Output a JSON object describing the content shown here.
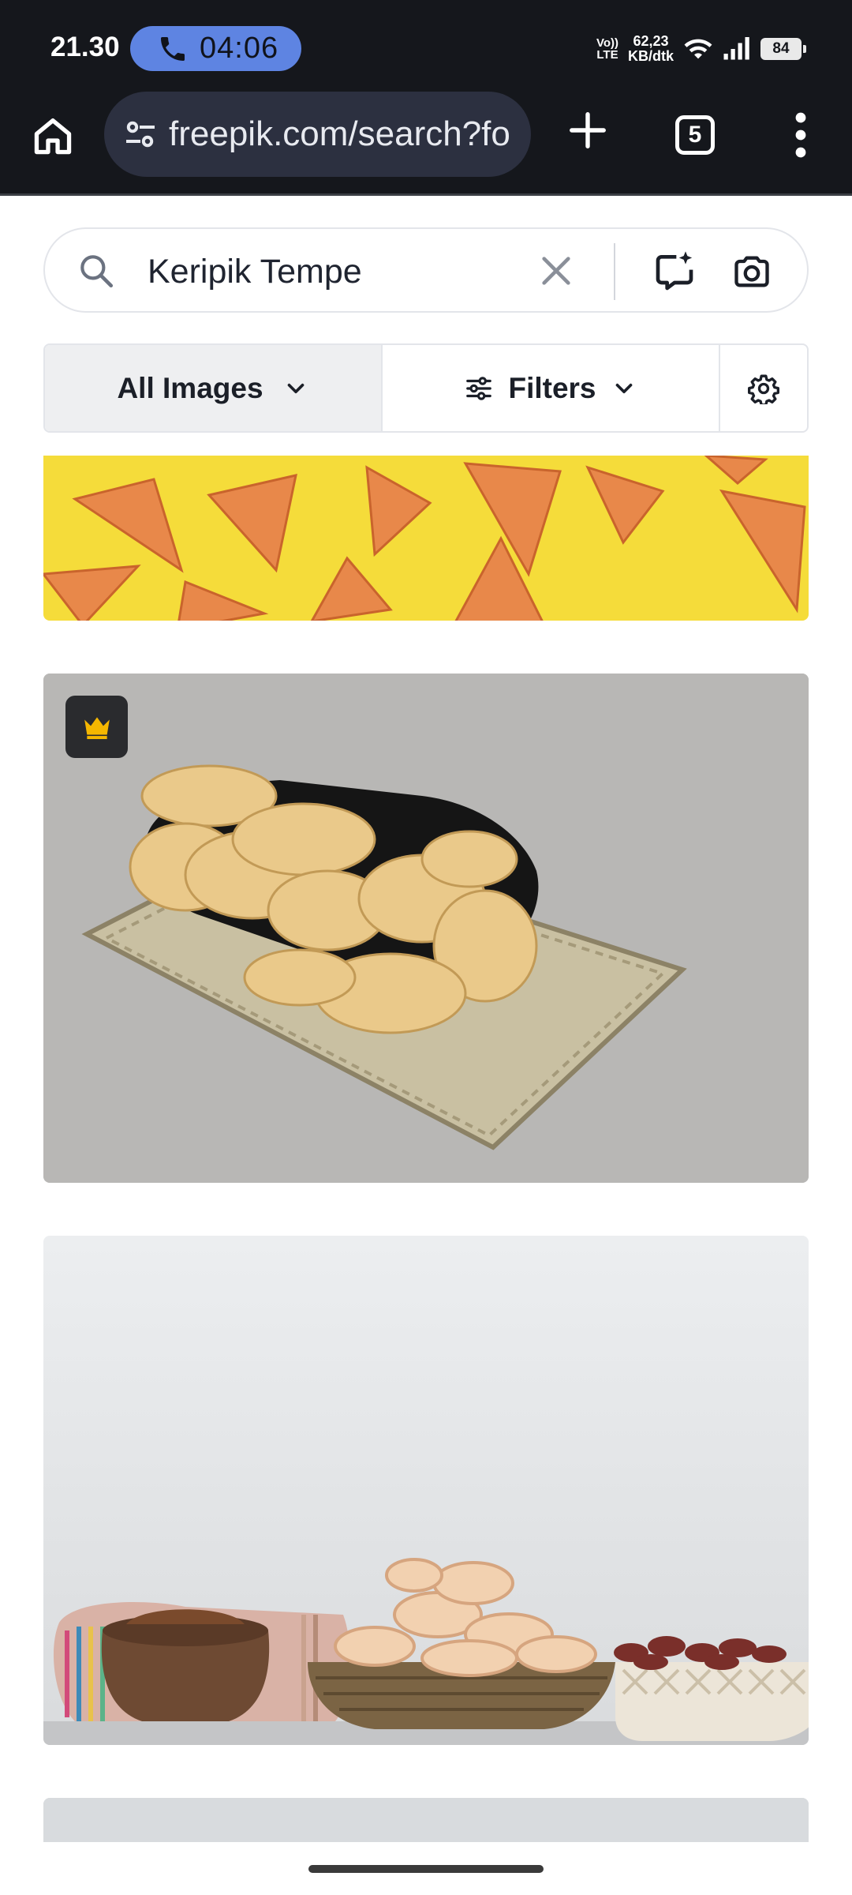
{
  "status_bar": {
    "time": "21.30",
    "call_timer": "04:06",
    "volte_line1": "Vo))",
    "volte_line2": "LTE",
    "net_speed_value": "62,23",
    "net_speed_unit": "KB/dtk",
    "battery": "84",
    "icons": [
      "phone-icon",
      "wifi-icon",
      "signal-icon",
      "battery-icon"
    ]
  },
  "browser": {
    "url": "freepik.com/search?fo",
    "tab_count": "5",
    "icons": [
      "home-icon",
      "site-settings-icon",
      "new-tab-icon",
      "tab-switcher-icon",
      "more-menu-icon"
    ]
  },
  "search": {
    "query": "Keripik Tempe",
    "icons": [
      "search-icon",
      "clear-icon",
      "ai-chat-icon",
      "camera-search-icon"
    ]
  },
  "filters": {
    "all_images_label": "All Images",
    "filters_label": "Filters",
    "icons": [
      "chevron-down-icon",
      "sliders-icon",
      "gear-icon"
    ]
  },
  "results": [
    {
      "kind": "photo",
      "premium": false
    },
    {
      "kind": "photo",
      "premium": true
    },
    {
      "kind": "photo",
      "premium": false
    },
    {
      "kind": "photo",
      "premium": false
    }
  ],
  "colors": {
    "status_bar_bg": "#15171c",
    "call_chip": "#5e84e2",
    "omnibox_bg": "#2c3040",
    "active_filter_bg": "#eeeff1",
    "premium_crown": "#f5b700"
  }
}
